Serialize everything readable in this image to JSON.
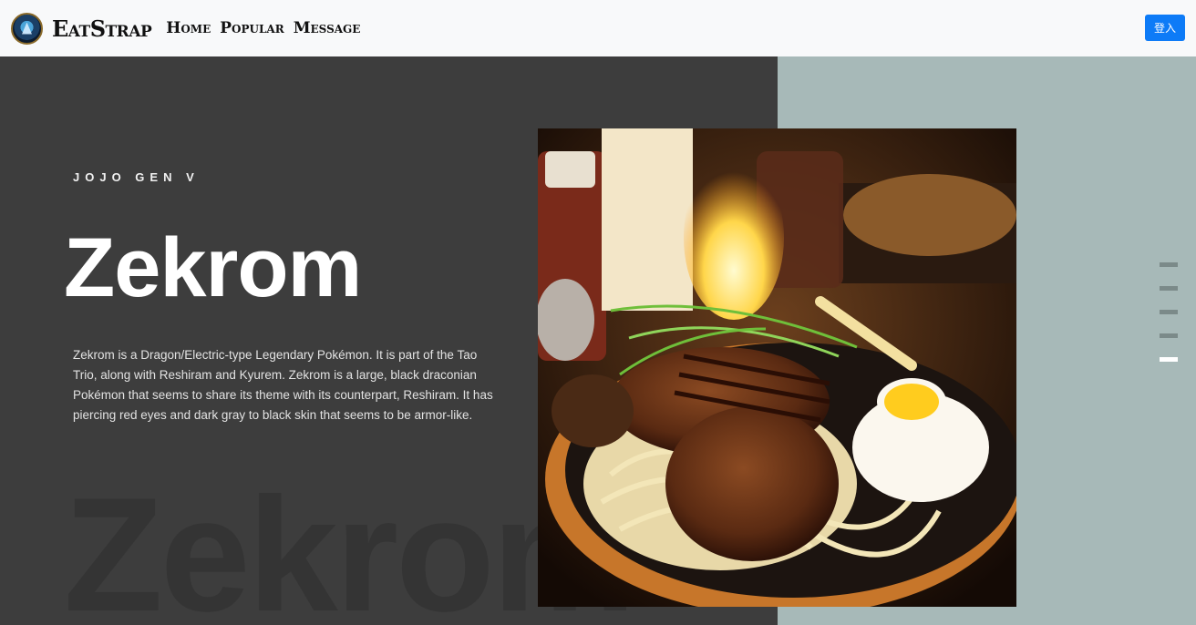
{
  "nav": {
    "brand": "EatStrap",
    "links": [
      "Home",
      "Popular",
      "Message"
    ],
    "login": "登入"
  },
  "hero": {
    "kicker": "JOJO GEN V",
    "title": "Zekrom",
    "description": "Zekrom is a Dragon/Electric-type Legendary Pokémon. It is part of the Tao Trio, along with Reshiram and Kyurem. Zekrom is a large, black draconian Pokémon that seems to share its theme with its counterpart, Reshiram. It has piercing red eyes and dark gray to black skin that seems to be armor-like.",
    "ghost_text": "Zekrom"
  },
  "slider": {
    "count": 5,
    "active_index": 4
  },
  "colors": {
    "navbar_bg": "#f8f9fa",
    "hero_dark": "#3d3d3d",
    "hero_light": "#a7b9b8",
    "login_btn": "#0d7bf7"
  }
}
